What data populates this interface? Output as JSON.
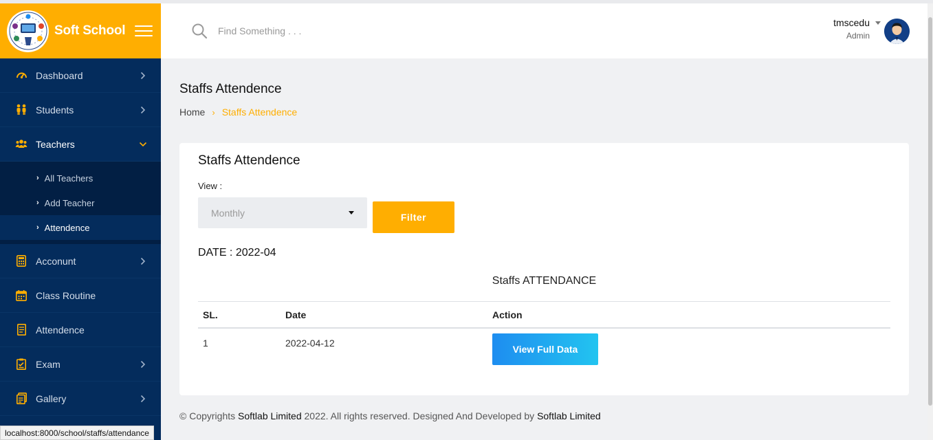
{
  "app": {
    "brand_name": "Soft School",
    "colors": {
      "brand": "#ffae01",
      "sidebar": "#042c5c",
      "submenu": "#021f44",
      "accent_blue": "#1e8df0"
    }
  },
  "header": {
    "search_placeholder": "Find Something . . .",
    "username": "tmscedu",
    "role": "Admin"
  },
  "sidebar": {
    "items": [
      {
        "label": "Dashboard",
        "icon": "speedometer-icon",
        "has_chevron": true
      },
      {
        "label": "Students",
        "icon": "users-icon",
        "has_chevron": true
      },
      {
        "label": "Teachers",
        "icon": "group-icon",
        "expanded": true
      },
      {
        "label": "Acconunt",
        "icon": "calculator-icon",
        "has_chevron": true
      },
      {
        "label": "Class Routine",
        "icon": "calendar-icon",
        "has_chevron": false
      },
      {
        "label": "Attendence",
        "icon": "document-icon",
        "has_chevron": false
      },
      {
        "label": "Exam",
        "icon": "clipboard-icon",
        "has_chevron": true
      },
      {
        "label": "Gallery",
        "icon": "gallery-icon",
        "has_chevron": true
      }
    ],
    "teachers_submenu": [
      {
        "label": "All Teachers"
      },
      {
        "label": "Add Teacher"
      },
      {
        "label": "Attendence",
        "active": true
      }
    ]
  },
  "page": {
    "title": "Staffs Attendence",
    "breadcrumb": {
      "home": "Home",
      "current": "Staffs Attendence"
    }
  },
  "card": {
    "title": "Staffs Attendence",
    "view_label": "View :",
    "view_selected": "Monthly",
    "filter_label": "Filter",
    "date_line": "DATE : 2022-04",
    "table_caption": "Staffs ATTENDANCE",
    "table": {
      "columns": [
        "SL.",
        "Date",
        "Action"
      ],
      "rows": [
        {
          "sl": "1",
          "date": "2022-04-12",
          "action_label": "View Full Data"
        }
      ]
    }
  },
  "footer": {
    "prefix": "© Copyrights ",
    "company": "Softlab Limited",
    "middle": " 2022. All rights reserved. Designed And Developed by ",
    "company2": "Softlab Limited"
  },
  "browser": {
    "status_url": "localhost:8000/school/staffs/attendance"
  }
}
